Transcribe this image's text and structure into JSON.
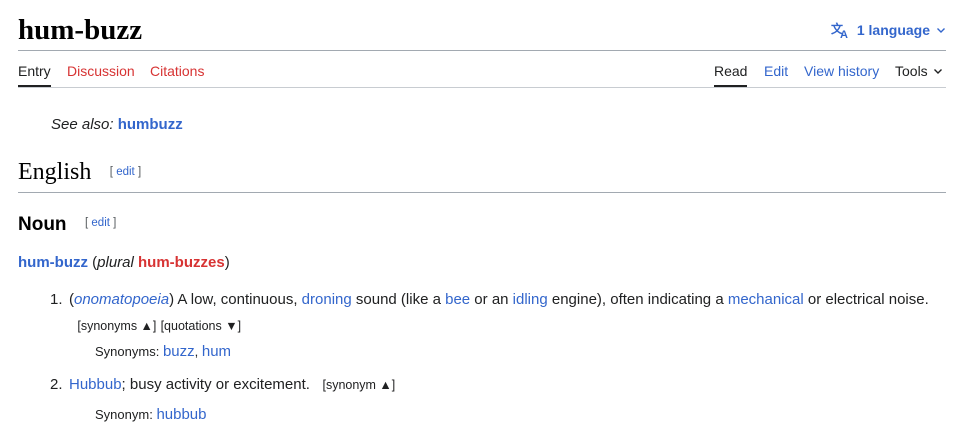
{
  "page": {
    "title": "hum-buzz",
    "language_button": "1 language"
  },
  "tabs": {
    "entry": "Entry",
    "discussion": "Discussion",
    "citations": "Citations",
    "read": "Read",
    "edit": "Edit",
    "view_history": "View history",
    "tools": "Tools"
  },
  "see_also": {
    "label": "See also:",
    "link": "humbuzz"
  },
  "sections": {
    "english": {
      "heading": "English",
      "edit_open": "[",
      "edit": "edit",
      "edit_close": "]"
    },
    "noun": {
      "heading": "Noun",
      "edit_open": "[",
      "edit": "edit",
      "edit_close": "]"
    }
  },
  "headword": {
    "word": "hum-buzz",
    "open_paren": "(",
    "plural_label": "plural",
    "plural_form": "hum-buzzes",
    "close_paren": ")"
  },
  "definitions": [
    {
      "number": "1.",
      "parts": {
        "p1": "(",
        "label": "onomatopoeia",
        "p2": ") A low, continuous, ",
        "l1": "droning",
        "p3": " sound (like a ",
        "l2": "bee",
        "p4": " or an ",
        "l3": "idling",
        "p5": " engine), often indicating a ",
        "l4": "mechanical",
        "p6": " or electrical noise."
      },
      "toggles": {
        "synonyms": "[synonyms ▲]",
        "quotations": "[quotations ▼]"
      },
      "synonyms_label": "Synonyms:",
      "synonyms": [
        "buzz",
        "hum"
      ]
    },
    {
      "number": "2.",
      "parts": {
        "l1": "Hubbub",
        "p1": "; busy activity or excitement."
      },
      "toggles": {
        "synonym": "[synonym ▲]"
      },
      "synonyms_label": "Synonym:",
      "synonyms": [
        "hubbub"
      ]
    }
  ],
  "icons": {
    "language": "translate-icon",
    "chevron": "chevron-down-icon"
  },
  "colors": {
    "link": "#3366cc",
    "redlink": "#d73333",
    "text": "#202122"
  }
}
